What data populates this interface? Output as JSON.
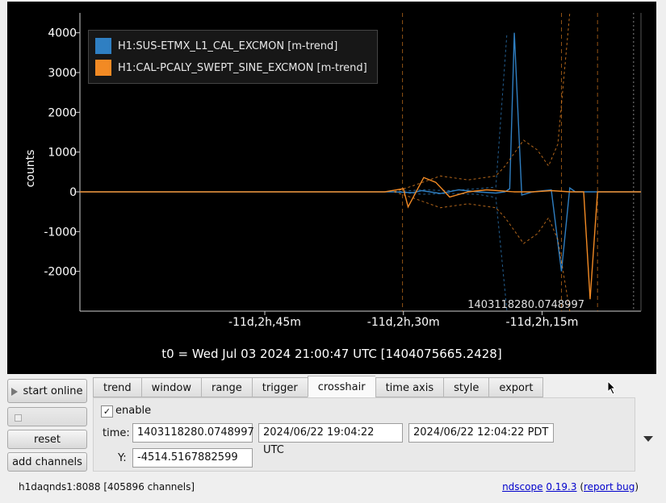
{
  "plot": {
    "y_axis_label": "counts",
    "t0_label": "t0 = Wed Jul 03 2024 21:00:47 UTC [1404075665.2428]",
    "crosshair_readout": "1403118280.0748997"
  },
  "chart_data": {
    "type": "line",
    "y_ticks": [
      4000,
      3000,
      2000,
      1000,
      0,
      -1000,
      -2000
    ],
    "y_tick_labels": [
      "4000",
      "3000",
      "2000",
      "1000",
      "0",
      "-1000",
      "-2000"
    ],
    "ylim": [
      -3000,
      4500
    ],
    "x_tick_labels": [
      "-11d,2h,45m",
      "-11d,2h,30m",
      "-11d,2h,15m",
      "-11d,2h"
    ],
    "x_ticks_minutes": [
      -45,
      -30,
      -15,
      0
    ],
    "xlim_minutes": [
      -65,
      -4.3
    ],
    "grid": false,
    "legend": "top-left",
    "series": [
      {
        "name": "H1:SUS-ETMX_L1_CAL_EXCMON [m-trend]",
        "color": "#2f7fc2",
        "mean": [
          [
            -65,
            0
          ],
          [
            -35,
            0
          ],
          [
            -31,
            0
          ],
          [
            -29,
            -20
          ],
          [
            -28,
            30
          ],
          [
            -26,
            -40
          ],
          [
            -24,
            50
          ],
          [
            -22,
            0
          ],
          [
            -20,
            -30
          ],
          [
            -19,
            0
          ],
          [
            -18.5,
            80
          ],
          [
            -18,
            4000
          ],
          [
            -17.2,
            -80
          ],
          [
            -16,
            0
          ],
          [
            -14,
            50
          ],
          [
            -12.9,
            -2000
          ],
          [
            -12,
            100
          ],
          [
            -11.4,
            0
          ],
          [
            -4.3,
            0
          ]
        ],
        "max": [
          [
            -31,
            0
          ],
          [
            -28,
            50
          ],
          [
            -25,
            30
          ],
          [
            -22,
            80
          ],
          [
            -20,
            120
          ],
          [
            -18.8,
            4000
          ]
        ],
        "min": [
          [
            -31,
            0
          ],
          [
            -28,
            -60
          ],
          [
            -25,
            -40
          ],
          [
            -22,
            -60
          ],
          [
            -20,
            -140
          ],
          [
            -18.8,
            -3000
          ]
        ]
      },
      {
        "name": "H1:CAL-PCALY_SWEPT_SINE_EXCMON [m-trend]",
        "color": "#f28a24",
        "mean": [
          [
            -65,
            0
          ],
          [
            -32,
            0
          ],
          [
            -30,
            80
          ],
          [
            -29.5,
            -380
          ],
          [
            -27.8,
            360
          ],
          [
            -26.5,
            240
          ],
          [
            -25,
            -130
          ],
          [
            -23,
            0
          ],
          [
            -21,
            50
          ],
          [
            -18,
            0
          ],
          [
            -16,
            0
          ],
          [
            -14,
            30
          ],
          [
            -12,
            0
          ],
          [
            -10.5,
            0
          ],
          [
            -9.8,
            -2700
          ],
          [
            -9,
            0
          ],
          [
            -4.3,
            0
          ]
        ],
        "max": [
          [
            -31,
            0
          ],
          [
            -29,
            150
          ],
          [
            -26,
            400
          ],
          [
            -23,
            300
          ],
          [
            -20,
            400
          ],
          [
            -19,
            650
          ],
          [
            -17,
            1300
          ],
          [
            -15.5,
            1050
          ],
          [
            -14.3,
            650
          ],
          [
            -13.3,
            1200
          ],
          [
            -12,
            4500
          ]
        ],
        "min": [
          [
            -31,
            0
          ],
          [
            -29,
            -150
          ],
          [
            -26,
            -400
          ],
          [
            -23,
            -300
          ],
          [
            -20,
            -400
          ],
          [
            -19,
            -650
          ],
          [
            -17,
            -1300
          ],
          [
            -15.5,
            -1050
          ],
          [
            -14.3,
            -650
          ],
          [
            -13.3,
            -1200
          ],
          [
            -12,
            -3000
          ]
        ]
      }
    ],
    "vertical_markers_minutes": [
      -30.1,
      -12.9,
      -9.0,
      -5.1
    ]
  },
  "sidebar": {
    "start_online_label": "start online",
    "disabled_label": "",
    "reset_label": "reset",
    "add_channels_label": "add channels"
  },
  "tabs": [
    "trend",
    "window",
    "range",
    "trigger",
    "crosshair",
    "time axis",
    "style",
    "export"
  ],
  "crosshair": {
    "enable_label": "enable",
    "enable_checked": "✓",
    "time_label": "time:",
    "time_gps": "1403118280.0748997",
    "time_utc": "2024/06/22 19:04:22 UTC",
    "time_pdt": "2024/06/22 12:04:22 PDT",
    "y_label": "Y:",
    "y_value": "-4514.5167882599"
  },
  "status": {
    "server": "h1daqnds1:8088  [405896 channels]",
    "app_link": "ndscope",
    "version_link": "0.19.3",
    "open_paren": "(",
    "report_link": "report bug",
    "close_paren": ")"
  },
  "colors": {
    "plot_bg": "#000000",
    "axis": "#cfcfcf",
    "series1": "#2f7fc2",
    "series2": "#f28a24"
  }
}
